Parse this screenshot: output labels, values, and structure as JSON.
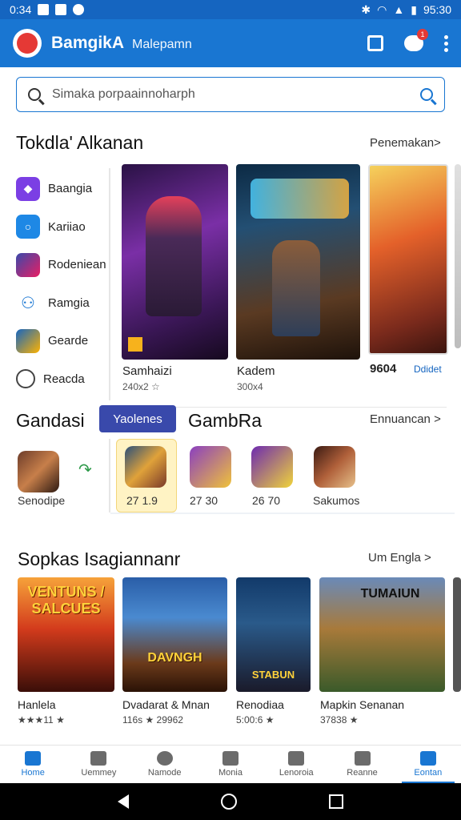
{
  "status_bar": {
    "time": "0:34",
    "clock": "95:30"
  },
  "app_bar": {
    "title": "BamgikA",
    "subtitle": "Malepamn",
    "notification_badge": "1"
  },
  "search": {
    "placeholder": "Simaka porpaainnoharph"
  },
  "section1": {
    "title": "Tokdla' Alkanan",
    "more": "Penemakan>",
    "sidebar": [
      {
        "label": "Baangia",
        "icon": "game-icon",
        "color": "#7b3fe4"
      },
      {
        "label": "Kariiao",
        "icon": "ring-icon",
        "color": "#1e88e5"
      },
      {
        "label": "Rodeniean",
        "icon": "avatar-icon",
        "color": "#3949ab"
      },
      {
        "label": "Ramgia",
        "icon": "person-icon",
        "color": "#ffffff"
      },
      {
        "label": "Gearde",
        "icon": "gamepad-icon",
        "color": "#1565c0"
      },
      {
        "label": "Reacda",
        "icon": "chat-icon",
        "color": "#ffffff"
      }
    ],
    "featured": [
      {
        "name": "Samhaizi",
        "meta": "240x2 ☆"
      },
      {
        "name": "Kadem",
        "meta": "300x4"
      },
      {
        "name": "9604",
        "meta": "Ddidet"
      }
    ]
  },
  "section2": {
    "title": "Gandasi",
    "pill": "Yaolenes",
    "title2": "GambRa",
    "more": "Ennuancan >",
    "apps": [
      {
        "label": "Senodipe"
      },
      {
        "label": "27 1.9"
      },
      {
        "label": "27 30"
      },
      {
        "label": "26 70"
      },
      {
        "label": "Sakumos"
      }
    ]
  },
  "section3": {
    "title": "Sopkas Isagiannanr",
    "more": "Um Engla >",
    "cards": [
      {
        "name": "Hanlela",
        "meta": "★★★11 ★",
        "art": "VENTUNS / SALCUES"
      },
      {
        "name": "Dvadarat & Mnan",
        "meta": "116s ★ 29962",
        "art": "DAVNGH"
      },
      {
        "name": "Renodiaa",
        "meta": "5:00:6 ★",
        "art": "STABUN"
      },
      {
        "name": "Mapkin Senanan",
        "meta": "37838 ★",
        "art": "TUMAIUN"
      }
    ]
  },
  "bottom_nav": [
    "Home",
    "Uemmey",
    "Namode",
    "Monia",
    "Lenoroia",
    "Reanne",
    "Eontan"
  ]
}
